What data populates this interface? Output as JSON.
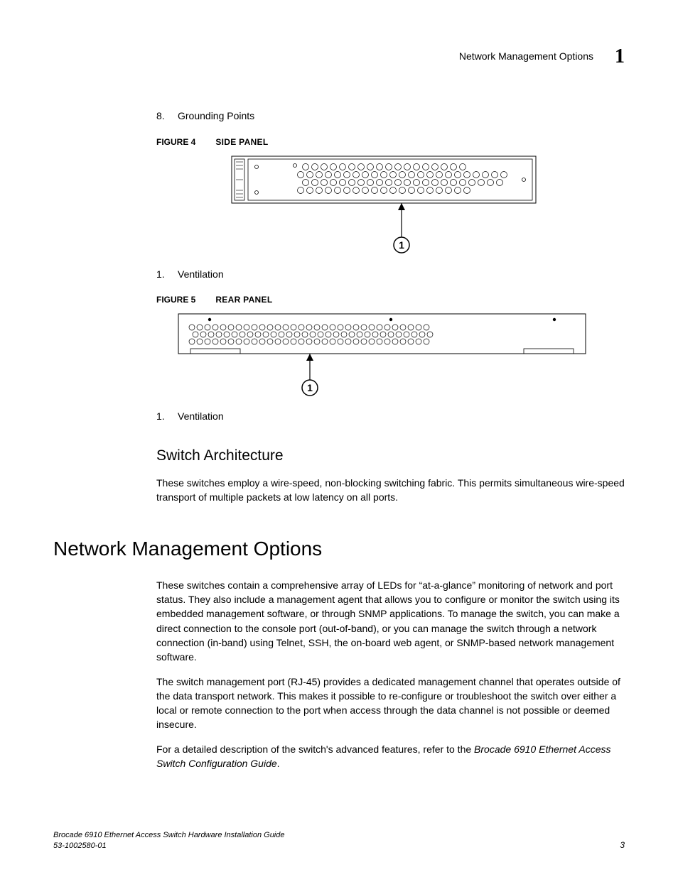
{
  "header": {
    "section_title": "Network Management Options",
    "chapter_number": "1"
  },
  "list_top": {
    "num": "8.",
    "text": "Grounding Points"
  },
  "figure4": {
    "label": "FIGURE 4",
    "title": "SIDE PANEL",
    "callout_num": "1",
    "legend_num": "1.",
    "legend_text": "Ventilation"
  },
  "figure5": {
    "label": "FIGURE 5",
    "title": "REAR PANEL",
    "callout_num": "1",
    "legend_num": "1.",
    "legend_text": "Ventilation"
  },
  "section_switch": {
    "heading": "Switch Architecture",
    "para": "These switches employ a wire-speed, non-blocking switching fabric. This permits simultaneous wire-speed transport of multiple packets at low latency on all ports."
  },
  "section_network": {
    "heading": "Network Management Options",
    "para1": "These switches contain a comprehensive array of LEDs for “at-a-glance” monitoring of network and port status. They also include a management agent that allows you to configure or monitor the switch using its embedded management software, or through SNMP applications. To manage the switch, you can make a direct connection to the console port (out-of-band), or you can manage the switch through a network connection (in-band) using Telnet, SSH, the on-board web agent, or SNMP-based network management software.",
    "para2": "The switch management port (RJ-45) provides a dedicated management channel that operates outside of the data transport network. This makes it possible to re-configure or troubleshoot the switch over either a local or remote connection to the port when access through the data channel is not possible or deemed insecure.",
    "para3_pre": "For a detailed description of the switch's advanced features, refer to the ",
    "para3_em": "Brocade 6910 Ethernet Access Switch Configuration Guide",
    "para3_post": "."
  },
  "footer": {
    "line1": "Brocade 6910 Ethernet Access Switch Hardware Installation Guide",
    "line2": "53-1002580-01",
    "page": "3"
  }
}
